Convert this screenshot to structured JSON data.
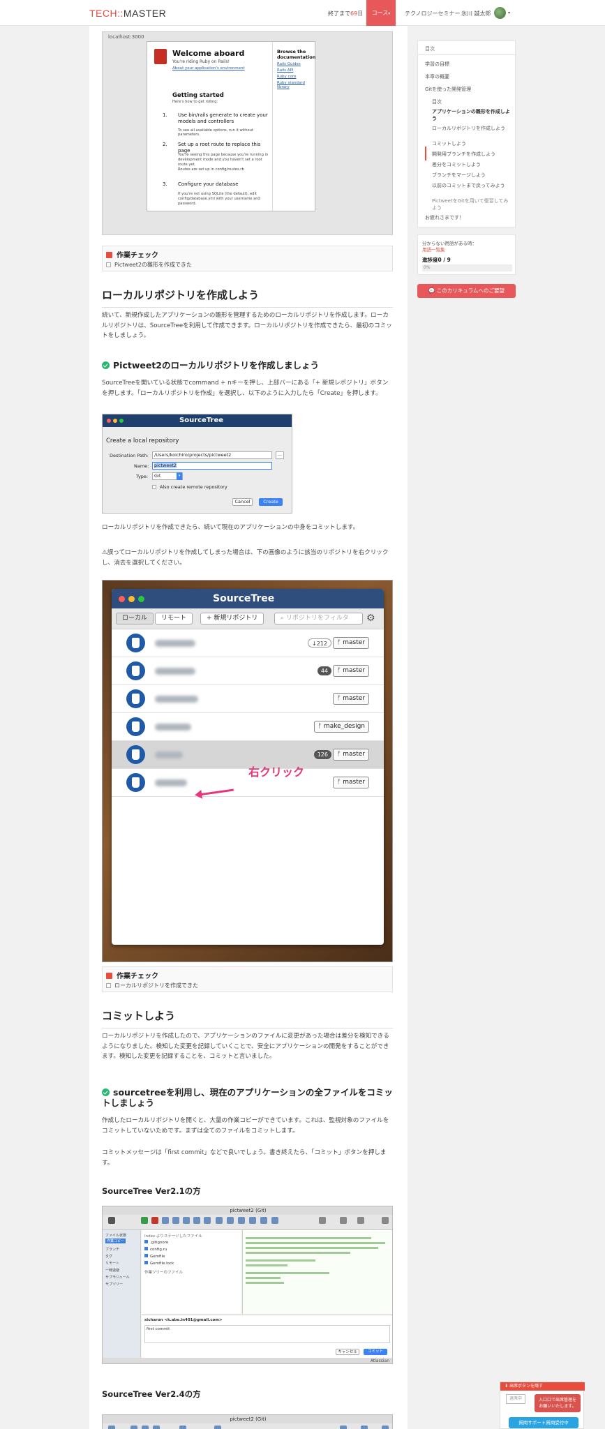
{
  "header": {
    "logo_prefix": "TECH",
    "logo_sep": "::",
    "logo_suffix": "MASTER",
    "days_label": "終了まで",
    "days_value": "69",
    "days_unit": "日",
    "course_label": "コース",
    "seminar_label": "テクノロジーセミナー",
    "user_name": "氷川 誠太郎"
  },
  "rails": {
    "url": "localhost:3000",
    "title": "Welcome aboard",
    "subtitle": "You're riding Ruby on Rails!",
    "env_link": "About your application's environment",
    "getting_started": "Getting started",
    "how_to": "Here's how to get rolling:",
    "steps": [
      {
        "num": "1.",
        "title": "Use bin/rails generate to create your models and controllers",
        "desc": "To see all available options, run it without parameters."
      },
      {
        "num": "2.",
        "title": "Set up a root route to replace this page",
        "desc": "You're seeing this page because you're running in development mode and you haven't set a root route yet.",
        "desc2": "Routes are set up in config/routes.rb"
      },
      {
        "num": "3.",
        "title": "Configure your database",
        "desc": "If you're not using SQLite (the default), edit config/database.yml with your username and password."
      }
    ],
    "browse_title": "Browse the documentation",
    "links": [
      "Rails Guides",
      "Rails API",
      "Ruby core",
      "Ruby standard library"
    ]
  },
  "task1": {
    "title": "作業チェック",
    "item": "Pictweet2の雛形を作成できた"
  },
  "section1": {
    "title": "ローカルリポジトリを作成しよう",
    "body": "続いて、新規作成したアプリケーションの雛形を管理するためのローカルリポジトリを作成します。ローカルリポジトリは、SourceTreeを利用して作成できます。ローカルリポジトリを作成できたら、最初のコミットをしましょう。",
    "sub_title": "Pictweet2のローカルリポジトリを作成しましょう",
    "sub_body": "SourceTreeを開いている状態でcommand + nキーを押し、上部バーにある「+ 新規レポジトリ」ボタンを押します。「ローカルリポジトリを作成」を選択し、以下のように入力したら「Create」を押します。"
  },
  "create_dialog": {
    "app_title": "SourceTree",
    "heading": "Create a local repository",
    "dest_label": "Destination Path:",
    "dest_value": "/Users/koichiro/projects/pictweet2",
    "name_label": "Name:",
    "name_value": "pictweet2",
    "type_label": "Type:",
    "type_value": "Git",
    "remote_label": "Also create remote repository",
    "cancel": "Cancel",
    "create": "Create"
  },
  "after_create": {
    "p1": "ローカルリポジトリを作成できたら、続いて現在のアプリケーションの中身をコミットします。",
    "warning": "⚠誤ってローカルリポジトリを作成してしまった場合は、下の画像のように該当のリポジトリを右クリックし、消去を選択してください。"
  },
  "repo_window": {
    "title": "SourceTree",
    "tab_local": "ローカル",
    "tab_remote": "リモート",
    "new_repo": "+ 新規リポジトリ",
    "filter_placeholder": "リポジトリをフィルタ",
    "repos": [
      {
        "count": "↓212",
        "branch": "master"
      },
      {
        "count": "44",
        "branch": "master"
      },
      {
        "count": "",
        "branch": "master"
      },
      {
        "count": "",
        "branch": "make_design"
      },
      {
        "count": "126",
        "branch": "master"
      },
      {
        "count": "",
        "branch": "master"
      }
    ],
    "annotation": "右クリック"
  },
  "task2": {
    "title": "作業チェック",
    "item": "ローカルリポジトリを作成できた"
  },
  "section2": {
    "title": "コミットしよう",
    "body": "ローカルリポジトリを作成したので、アプリケーションのファイルに変更があった場合は差分を検知できるようになりました。検知した変更を記録していくことで、安全にアプリケーションの開発をすることができます。検知した変更を記録することを、コミットと言いました。",
    "sub_title": "sourcetreeを利用し、現在のアプリケーションの全ファイルをコミットしましょう",
    "sub_body": "作成したローカルリポジトリを開くと、大量の作業コピーができています。これは、監視対象のファイルをコミットしていないためです。まずは全てのファイルをコミットします。",
    "sub_body2": "コミットメッセージは「first commit」などで良いでしょう。書き終えたら、「コミット」ボタンを押します。",
    "v21": "SourceTree Ver2.1の方",
    "v24": "SourceTree Ver2.4の方"
  },
  "st21": {
    "window_title": "pictweet2 (Git)",
    "staged_label": "Index よりステージしたファイル",
    "files": [
      ".gitignore",
      "config.ru",
      "Gemfile",
      "Gemfile.lock"
    ],
    "unstaged_label": "作業ツリーのファイル",
    "sidebar": [
      "ファイル状態",
      "作業コピー",
      "ブランチ",
      "タグ",
      "リモート",
      "一時退避",
      "サブモジュール",
      "サブツリー"
    ],
    "author": "sicharon <k.abe.in401@gmail.com>",
    "commit_msg": "first commit",
    "cancel": "キャンセル",
    "commit": "コミット",
    "footer": "Atlassian"
  },
  "st24": {
    "window_title": "pictweet2 (Git)"
  },
  "sidebar": {
    "toc_title": "目次",
    "items": [
      {
        "label": "学習の目標",
        "indent": 0
      },
      {
        "label": "本章の概要",
        "indent": 0
      },
      {
        "label": "Gitを使った開発管理",
        "indent": 0
      },
      {
        "label": "目次",
        "indent": 1
      },
      {
        "label": "アプリケーションの雛形を作成しよう",
        "indent": 1,
        "current": true
      },
      {
        "label": "ローカルリポジトリを作成しよう",
        "indent": 1
      },
      {
        "label": "コミットしよう",
        "indent": 1
      },
      {
        "label": "開発用ブランチを作成しよう",
        "indent": 1
      },
      {
        "label": "差分をコミットしよう",
        "indent": 1
      },
      {
        "label": "ブランチをマージしよう",
        "indent": 1
      },
      {
        "label": "以前のコミットまで戻ってみよう",
        "indent": 1
      },
      {
        "label": "PictweetをGitを用いて復習してみよう",
        "indent": 1
      },
      {
        "label": "お疲れさまです！",
        "indent": 0
      }
    ],
    "help_text": "分からない用語がある時：",
    "glossary_link": "用語一覧集",
    "progress_label": "進捗度0 / 9",
    "progress_value": 0,
    "progress_pct": "0%",
    "request_button": "このカリキュラムへのご要望"
  },
  "attendance": {
    "header": "出席ボタンを隠す",
    "absent_btn": "退席中",
    "message": "入口口で出席管理を お願いいたします。",
    "support": "質問サポート質問受付中"
  }
}
